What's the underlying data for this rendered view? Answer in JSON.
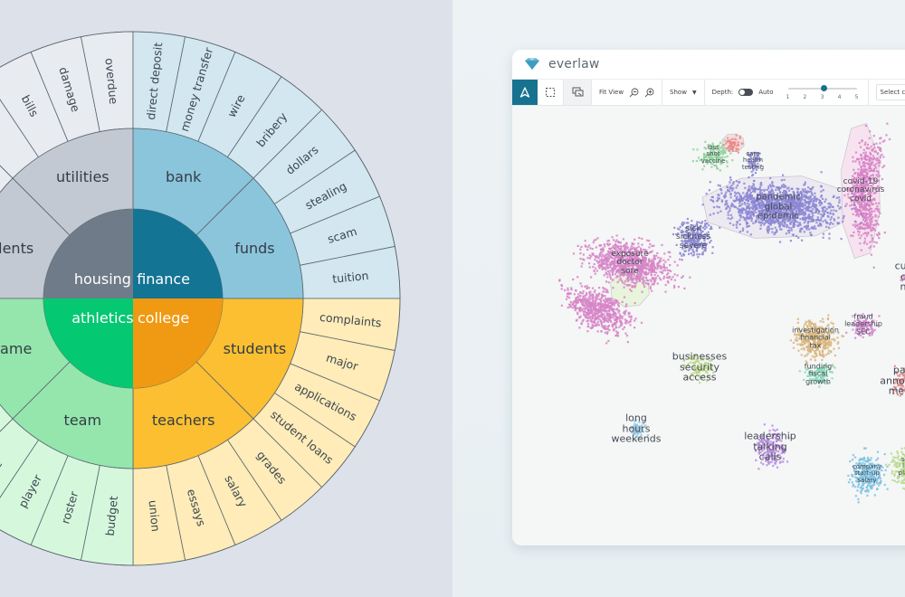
{
  "sunburst": {
    "center_labels": [
      "housing",
      "finance",
      "college",
      "athletics"
    ],
    "quadrants": [
      {
        "name": "housing",
        "color": "#6f7b88",
        "mid_color": "#c3c9d3",
        "outer_color": "#e8ebf0",
        "text_color": "#ffffff",
        "children": [
          {
            "label": "residents",
            "visible_label": "idents"
          },
          {
            "label": "utilities",
            "visible_label": "utilities"
          }
        ],
        "leaves": [
          "",
          "",
          "",
          "",
          "",
          "bills",
          "damage",
          "overdue"
        ]
      },
      {
        "name": "finance",
        "color": "#137494",
        "mid_color": "#8bc5dc",
        "outer_color": "#d2e7ef",
        "text_color": "#ffffff",
        "children": [
          {
            "label": "bank",
            "visible_label": "bank"
          },
          {
            "label": "funds",
            "visible_label": "funds"
          }
        ],
        "leaves": [
          "direct deposit",
          "money transfer",
          "wire",
          "bribery",
          "dollars",
          "stealing",
          "scam",
          "tuition"
        ]
      },
      {
        "name": "college",
        "color": "#ef9a12",
        "mid_color": "#fbbf31",
        "outer_color": "#ffecb8",
        "text_color": "#ffffff",
        "children": [
          {
            "label": "students",
            "visible_label": "students"
          },
          {
            "label": "teachers",
            "visible_label": "teachers"
          }
        ],
        "leaves": [
          "complaints",
          "major",
          "applications",
          "student loans",
          "grades",
          "salary",
          "essays",
          "union"
        ]
      },
      {
        "name": "athletics",
        "color": "#05c872",
        "mid_color": "#95e6ad",
        "outer_color": "#d5f8dc",
        "text_color": "#ffffff",
        "children": [
          {
            "label": "team",
            "visible_label": "team"
          },
          {
            "label": "game",
            "visible_label": "game"
          }
        ],
        "leaves": [
          "budget",
          "roster",
          "player",
          "ise",
          "",
          "",
          "",
          ""
        ]
      }
    ]
  },
  "app": {
    "brand": "everlaw",
    "accent_color": "#17728f",
    "toolbar": {
      "fit_view": "Fit View",
      "show": "Show",
      "depth_label": "Depth:",
      "auto_label": "Auto",
      "depth_ticks": [
        "1",
        "2",
        "3",
        "4",
        "5"
      ],
      "depth_value": 3,
      "select_placeholder": "Select clu"
    },
    "clusters": [
      {
        "id": "loss",
        "lines": [
          "loss",
          "shot",
          "vaccine"
        ],
        "color": "#8fd39a"
      },
      {
        "id": "red-small",
        "lines": [],
        "color": "#e98a8a"
      },
      {
        "id": "care",
        "lines": [
          "care",
          "health",
          "testing"
        ],
        "color": "#8b86d4"
      },
      {
        "id": "covid",
        "lines": [
          "covid-19",
          "coronavirus",
          "covid"
        ],
        "color": "#d684c7"
      },
      {
        "id": "pandemic",
        "lines": [
          "pandemic",
          "global",
          "epidemic"
        ],
        "color": "#8b86d4"
      },
      {
        "id": "sick",
        "lines": [
          "sick",
          "sickness",
          "severe"
        ],
        "color": "#8b86d4"
      },
      {
        "id": "exposure",
        "lines": [
          "exposure",
          "doctor",
          "sore"
        ],
        "color": "#d684c7"
      },
      {
        "id": "custom",
        "lines": [
          "cus",
          "c",
          "n"
        ],
        "color": "#d684c7"
      },
      {
        "id": "fraud",
        "lines": [
          "fraud",
          "leadership",
          "SEC"
        ],
        "color": "#d58ad0"
      },
      {
        "id": "investigation",
        "lines": [
          "investigation",
          "financial",
          "tax"
        ],
        "color": "#d9b57a"
      },
      {
        "id": "funding",
        "lines": [
          "funding",
          "fiscal",
          "growth"
        ],
        "color": "#86dbb7"
      },
      {
        "id": "businesses",
        "lines": [
          "businesses",
          "security",
          "access"
        ],
        "color": "#b8d87a"
      },
      {
        "id": "long",
        "lines": [
          "long",
          "hours",
          "weekends"
        ],
        "color": "#8fc6e0"
      },
      {
        "id": "leadership",
        "lines": [
          "leadership",
          "talking",
          "calls"
        ],
        "color": "#b88ae0"
      },
      {
        "id": "party",
        "lines": [
          "par",
          "announc",
          "meet"
        ],
        "color": "#e08a8a"
      },
      {
        "id": "company",
        "lines": [
          "company",
          "start-up",
          "salary"
        ],
        "color": "#7cc2e3"
      },
      {
        "id": "pla",
        "lines": [
          "s",
          "l",
          "pla"
        ],
        "color": "#b6d98a"
      }
    ]
  }
}
